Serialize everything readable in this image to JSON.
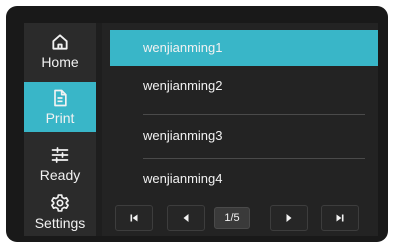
{
  "sidebar": {
    "items": [
      {
        "label": "Home",
        "icon": "home-icon",
        "active": false
      },
      {
        "label": "Print",
        "icon": "file-icon",
        "active": true
      },
      {
        "label": "Ready",
        "icon": "sliders-icon",
        "active": false
      },
      {
        "label": "Settings",
        "icon": "gear-icon",
        "active": false
      }
    ]
  },
  "files": {
    "items": [
      {
        "name": "wenjianming1",
        "selected": true
      },
      {
        "name": "wenjianming2",
        "selected": false
      },
      {
        "name": "wenjianming3",
        "selected": false
      },
      {
        "name": "wenjianming4",
        "selected": false
      }
    ]
  },
  "pager": {
    "indicator": "1/5",
    "first_icon": "skip-first-icon",
    "prev_icon": "prev-arrow-icon",
    "next_icon": "next-arrow-icon",
    "last_icon": "skip-last-icon"
  },
  "colors": {
    "accent": "#39b6c8",
    "bezel": "#191919",
    "sidebar_bg": "#2b2b2b",
    "list_bg": "#232323",
    "text": "#f2f2f2"
  }
}
